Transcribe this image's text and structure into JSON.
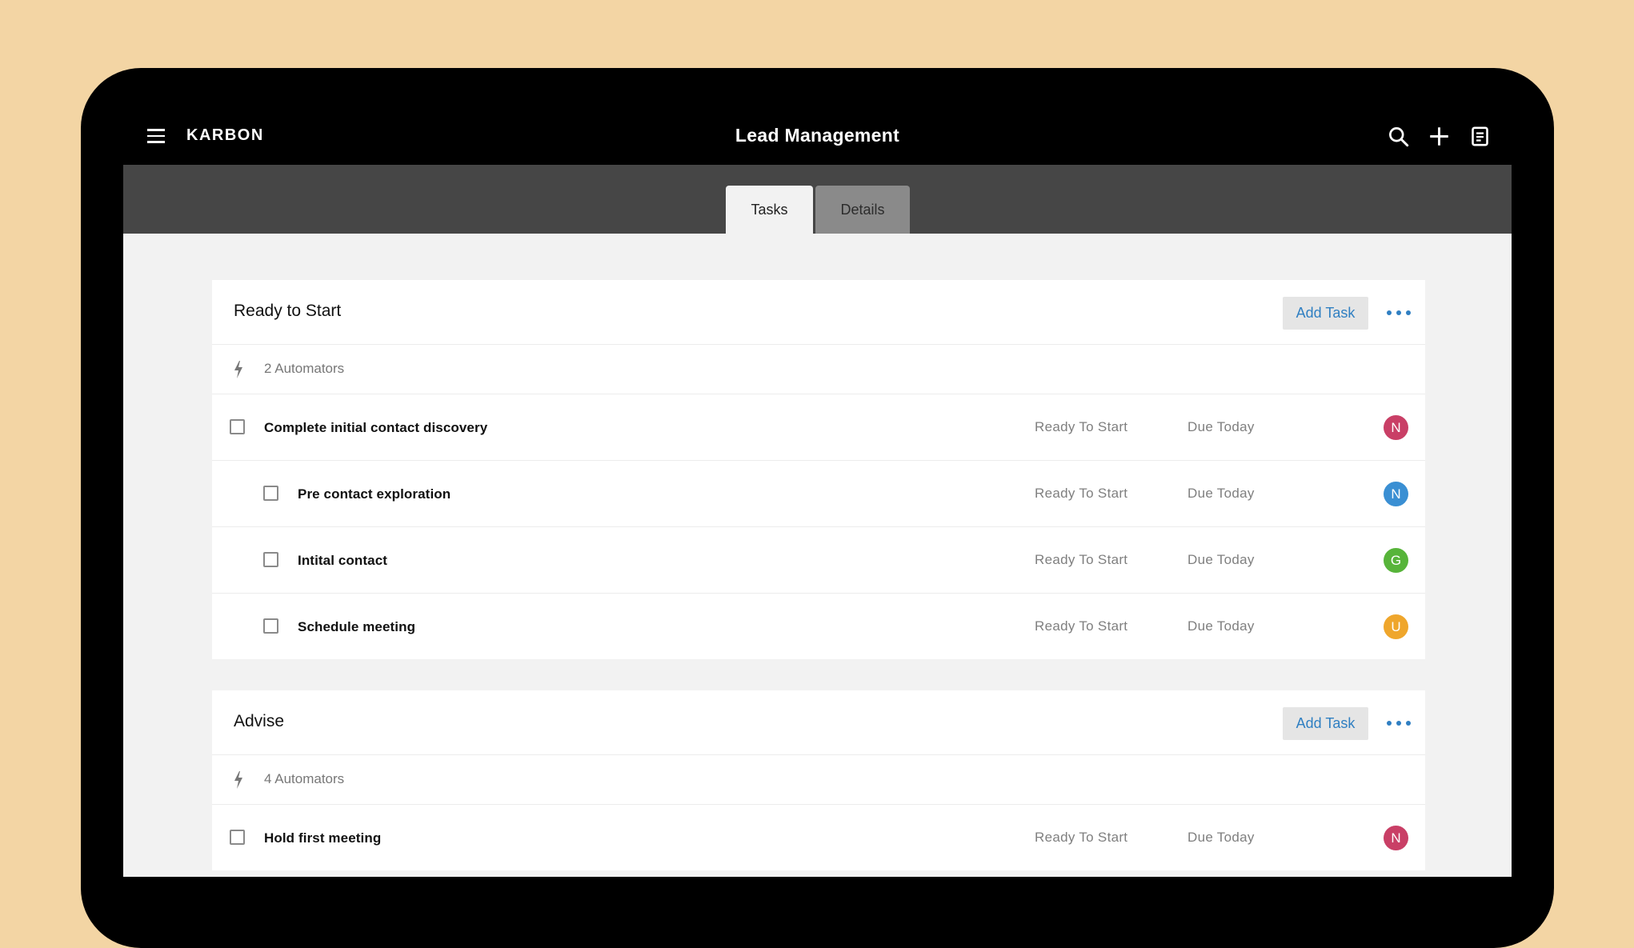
{
  "app": {
    "brand": "KARBON",
    "title": "Lead Management"
  },
  "icons": {
    "menu": "hamburger-menu-icon",
    "search": "search-icon",
    "add": "plus-icon",
    "notes": "notes-icon",
    "automator": "lightning-bolt-icon",
    "more": "more-horizontal-icon"
  },
  "tabs": [
    {
      "label": "Tasks",
      "active": true
    },
    {
      "label": "Details",
      "active": false
    }
  ],
  "colors": {
    "accent": "#2f7fc2",
    "avatar_n_red": "#c93f66",
    "avatar_n_blue": "#3a8fd3",
    "avatar_g": "#57b43a",
    "avatar_u": "#efa62c"
  },
  "sections": [
    {
      "title": "Ready to Start",
      "add_task_label": "Add Task",
      "automators": "2 Automators",
      "tasks": [
        {
          "name": "Complete initial contact discovery",
          "status": "Ready To Start",
          "due": "Due Today",
          "assignee": "N",
          "color": "#c93f66",
          "indent": 0
        },
        {
          "name": "Pre contact exploration",
          "status": "Ready To Start",
          "due": "Due Today",
          "assignee": "N",
          "color": "#3a8fd3",
          "indent": 1
        },
        {
          "name": "Intital contact",
          "status": "Ready To Start",
          "due": "Due Today",
          "assignee": "G",
          "color": "#57b43a",
          "indent": 1
        },
        {
          "name": "Schedule meeting",
          "status": "Ready To Start",
          "due": "Due Today",
          "assignee": "U",
          "color": "#efa62c",
          "indent": 1
        }
      ]
    },
    {
      "title": "Advise",
      "add_task_label": "Add Task",
      "automators": "4 Automators",
      "tasks": [
        {
          "name": "Hold first meeting",
          "status": "Ready To Start",
          "due": "Due Today",
          "assignee": "N",
          "color": "#c93f66",
          "indent": 0
        }
      ]
    }
  ]
}
